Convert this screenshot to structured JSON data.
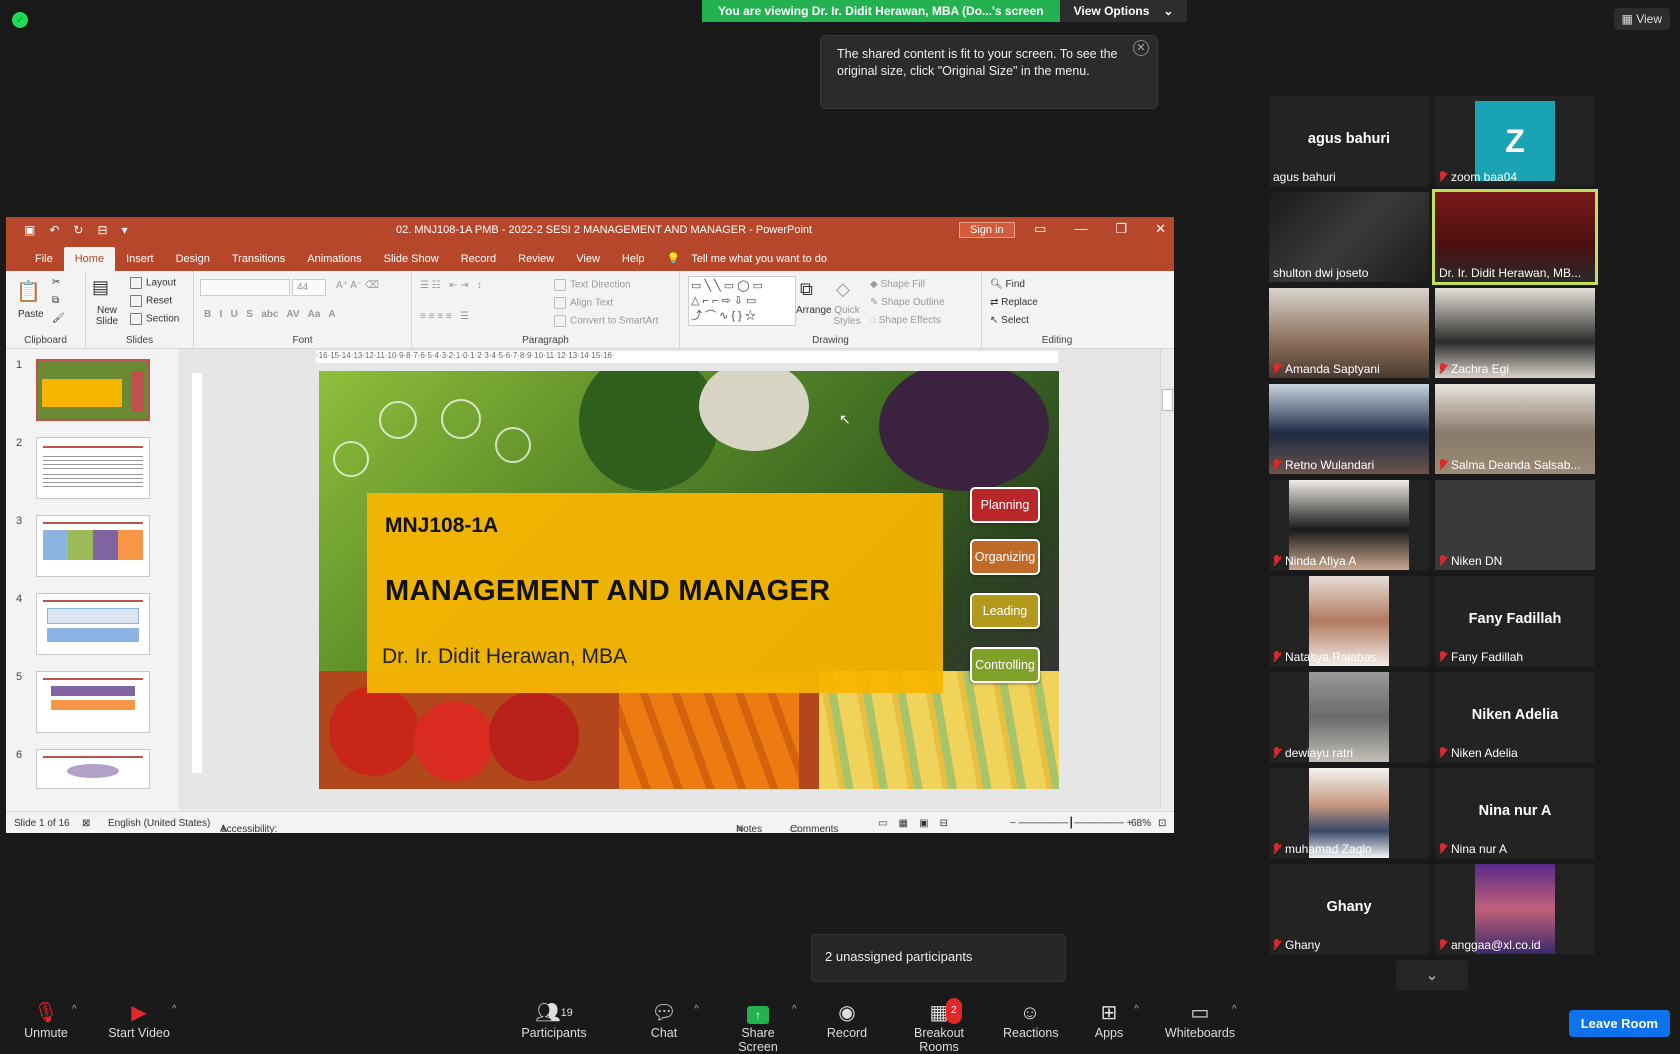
{
  "zoom": {
    "banner": "You are viewing Dr. Ir. Didit Herawan, MBA (Do...'s screen",
    "view_options": "View Options",
    "view_button": "View",
    "notice": "The shared content is fit to your screen. To see the original size, click \"Original Size\" in the menu.",
    "unassigned": "2 unassigned participants"
  },
  "ppt": {
    "title": "02. MNJ108-1A PMB - 2022-2  SESI 2  MANAGEMENT AND MANAGER  -  PowerPoint",
    "sign_in": "Sign in",
    "tabs": [
      "File",
      "Home",
      "Insert",
      "Design",
      "Transitions",
      "Animations",
      "Slide Show",
      "Record",
      "Review",
      "View",
      "Help"
    ],
    "tell_me": "Tell me what you want to do",
    "ribbon": {
      "paste": "Paste",
      "clipboard": "Clipboard",
      "new_slide": "New Slide",
      "layout": "Layout",
      "reset": "Reset",
      "section": "Section",
      "slides": "Slides",
      "font_size": "44",
      "font": "Font",
      "text_direction": "Text Direction",
      "align_text": "Align Text",
      "convert_smartart": "Convert to SmartArt",
      "paragraph": "Paragraph",
      "arrange": "Arrange",
      "quick_styles": "Quick Styles",
      "shape_fill": "Shape Fill",
      "shape_outline": "Shape Outline",
      "shape_effects": "Shape Effects",
      "drawing": "Drawing",
      "find": "Find",
      "replace": "Replace",
      "select": "Select",
      "editing": "Editing"
    },
    "thumbnails": [
      "1",
      "2",
      "3",
      "4",
      "5",
      "6"
    ],
    "slide": {
      "course": "MNJ108-1A",
      "title": "MANAGEMENT AND MANAGER",
      "author": "Dr. Ir. Didit Herawan, MBA",
      "functions": [
        "Planning",
        "Organizing",
        "Leading",
        "Controlling"
      ]
    },
    "status": {
      "slide": "Slide 1 of 16",
      "language": "English (United States)",
      "accessibility": "Accessibility: Investigate",
      "notes": "Notes",
      "comments": "Comments",
      "zoom": "68%"
    }
  },
  "participants": [
    {
      "name": "agus bahuri",
      "display": "agus bahuri",
      "muted": false
    },
    {
      "name": "zoom baa04",
      "display": "",
      "muted": true,
      "avatar": "Z"
    },
    {
      "name": "shulton dwi joseto",
      "display": "",
      "muted": false
    },
    {
      "name": "Dr. Ir. Didit Herawan, MB...",
      "display": "",
      "muted": false
    },
    {
      "name": "Amanda Saptyani",
      "display": "",
      "muted": true
    },
    {
      "name": "Zachra Egi",
      "display": "",
      "muted": true
    },
    {
      "name": "Retno Wulandari",
      "display": "",
      "muted": true
    },
    {
      "name": "Salma Deanda Salsab...",
      "display": "",
      "muted": true
    },
    {
      "name": "Ninda Afiya A",
      "display": "",
      "muted": true
    },
    {
      "name": "Niken DN",
      "display": "",
      "muted": true
    },
    {
      "name": "Natasya Rajabas",
      "display": "",
      "muted": true
    },
    {
      "name": "Fany Fadillah",
      "display": "Fany Fadillah",
      "muted": true
    },
    {
      "name": "dewiayu ratri",
      "display": "",
      "muted": true
    },
    {
      "name": "Niken Adelia",
      "display": "Niken Adelia",
      "muted": true
    },
    {
      "name": "muhamad Zaqlo",
      "display": "",
      "muted": true
    },
    {
      "name": "Nina nur A",
      "display": "Nina nur A",
      "muted": true
    },
    {
      "name": "Ghany",
      "display": "Ghany",
      "muted": true
    },
    {
      "name": "anggaa@xl.co.id",
      "display": "",
      "muted": true
    }
  ],
  "toolbar": {
    "unmute": "Unmute",
    "start_video": "Start Video",
    "participants": "Participants",
    "participant_count": "19",
    "chat": "Chat",
    "share_screen": "Share Screen",
    "record": "Record",
    "breakout_rooms": "Breakout Rooms",
    "breakout_badge": "2",
    "reactions": "Reactions",
    "apps": "Apps",
    "whiteboards": "Whiteboards",
    "leave": "Leave Room"
  }
}
